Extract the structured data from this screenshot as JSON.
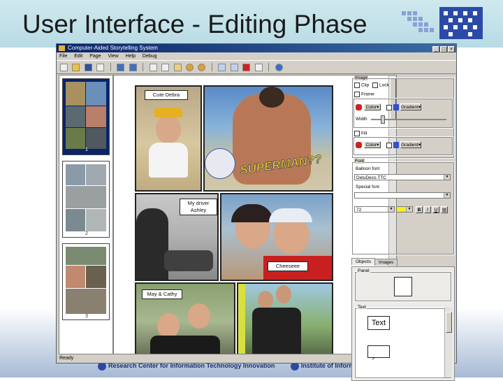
{
  "slide": {
    "title": "User Interface - Editing Phase",
    "footer_left": "Research Center for Information Technology Innovation",
    "footer_right": "Institute of Information Science, Academia Sinica"
  },
  "colors": {
    "window_title": "#0a246a",
    "accent_yellow": "#f4d21c",
    "selection_blue": "#0a246a"
  },
  "window": {
    "title": "Computer-Aided Storytelling System",
    "menu": [
      "File",
      "Edit",
      "Page",
      "View",
      "Help",
      "Debug"
    ],
    "toolbar_icons": [
      "new-icon",
      "open-icon",
      "save-icon",
      "print-icon",
      "undo-icon",
      "redo-icon",
      "cut-icon",
      "copy-icon",
      "paste-icon",
      "zoom-in-icon",
      "zoom-out-icon",
      "layout-icon",
      "page-icon",
      "delete-icon",
      "panel-icon",
      "help-icon"
    ],
    "status": "Ready"
  },
  "thumbnails": [
    {
      "number": "1",
      "selected": true
    },
    {
      "number": "2",
      "selected": false
    },
    {
      "number": "3",
      "selected": false
    }
  ],
  "comic": {
    "balloons": {
      "cute_debra": "Cute Debra",
      "my_driver": "My driver Ashley",
      "cheese": "Cheeseee",
      "may_cathy": "May & Cathy"
    },
    "sfx": "SUPERMAN??"
  },
  "properties": {
    "image_group": "Image",
    "clip": "Clip",
    "lock": "Lock",
    "frame": "Frame",
    "color": "Color",
    "gradient": "Gradient",
    "width": "Width",
    "fill": "Fill",
    "font_group": "Font",
    "balloon_font_label": "Balloon font",
    "font_value": "DeluDeco.TTC",
    "special_font_label": "Special font",
    "special_font_value": "",
    "font_size": "72",
    "bold": "B",
    "italic": "I",
    "underline": "U"
  },
  "tabs": [
    {
      "label": "Objects",
      "active": true
    },
    {
      "label": "Images",
      "active": false
    }
  ],
  "objects": {
    "panel_group": "Panel",
    "text_group": "Text",
    "text_sample": "Text"
  }
}
